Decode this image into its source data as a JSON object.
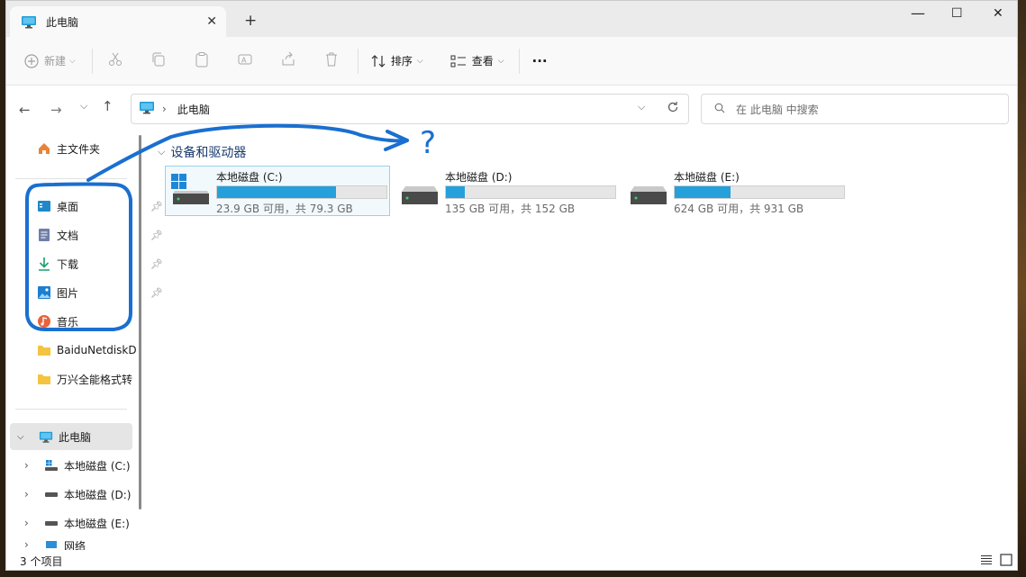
{
  "window": {
    "tab_title": "此电脑",
    "new_tab_label": "+"
  },
  "commandbar": {
    "new_label": "新建",
    "sort_label": "排序",
    "view_label": "查看",
    "more_label": "···"
  },
  "address": {
    "path": "此电脑",
    "separator": "›"
  },
  "search": {
    "placeholder": "在 此电脑 中搜索"
  },
  "sidebar": {
    "home": "主文件夹",
    "quick": [
      {
        "label": "桌面",
        "icon": "desktop-icon",
        "pinned": true
      },
      {
        "label": "文档",
        "icon": "document-icon",
        "pinned": true
      },
      {
        "label": "下载",
        "icon": "download-icon",
        "pinned": true
      },
      {
        "label": "图片",
        "icon": "pictures-icon",
        "pinned": true
      },
      {
        "label": "音乐",
        "icon": "music-icon",
        "pinned": false
      },
      {
        "label": "BaiduNetdiskD",
        "icon": "folder-icon",
        "pinned": false
      },
      {
        "label": "万兴全能格式转",
        "icon": "folder-icon",
        "pinned": false
      }
    ],
    "this_pc": "此电脑",
    "drives": [
      {
        "label": "本地磁盘 (C:)",
        "icon": "windows-drive-icon"
      },
      {
        "label": "本地磁盘 (D:)",
        "icon": "drive-icon"
      },
      {
        "label": "本地磁盘 (E:)",
        "icon": "drive-icon"
      }
    ],
    "network": "网络"
  },
  "content": {
    "group_title": "设备和驱动器",
    "drives": [
      {
        "name": "本地磁盘 (C:)",
        "info": "23.9 GB 可用，共 79.3 GB",
        "used_fraction": 0.7,
        "system": true
      },
      {
        "name": "本地磁盘 (D:)",
        "info": "135 GB 可用，共 152 GB",
        "used_fraction": 0.11,
        "system": false
      },
      {
        "name": "本地磁盘 (E:)",
        "info": "624 GB 可用，共 931 GB",
        "used_fraction": 0.33,
        "system": false
      }
    ]
  },
  "annotation": {
    "mark": "?",
    "color": "#1a6fd0"
  },
  "status": {
    "count": "3 个项目"
  },
  "colors": {
    "accent": "#26a0da",
    "selection_border": "#99d1ea"
  }
}
